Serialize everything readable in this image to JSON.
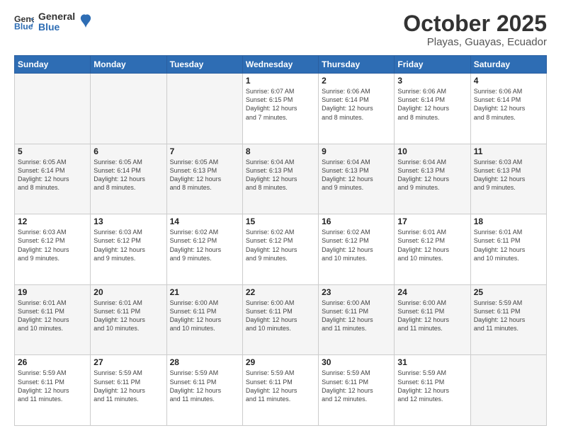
{
  "logo": {
    "line1": "General",
    "line2": "Blue"
  },
  "title": "October 2025",
  "subtitle": "Playas, Guayas, Ecuador",
  "days_of_week": [
    "Sunday",
    "Monday",
    "Tuesday",
    "Wednesday",
    "Thursday",
    "Friday",
    "Saturday"
  ],
  "weeks": [
    [
      {
        "day": "",
        "info": ""
      },
      {
        "day": "",
        "info": ""
      },
      {
        "day": "",
        "info": ""
      },
      {
        "day": "1",
        "info": "Sunrise: 6:07 AM\nSunset: 6:15 PM\nDaylight: 12 hours\nand 7 minutes."
      },
      {
        "day": "2",
        "info": "Sunrise: 6:06 AM\nSunset: 6:14 PM\nDaylight: 12 hours\nand 8 minutes."
      },
      {
        "day": "3",
        "info": "Sunrise: 6:06 AM\nSunset: 6:14 PM\nDaylight: 12 hours\nand 8 minutes."
      },
      {
        "day": "4",
        "info": "Sunrise: 6:06 AM\nSunset: 6:14 PM\nDaylight: 12 hours\nand 8 minutes."
      }
    ],
    [
      {
        "day": "5",
        "info": "Sunrise: 6:05 AM\nSunset: 6:14 PM\nDaylight: 12 hours\nand 8 minutes."
      },
      {
        "day": "6",
        "info": "Sunrise: 6:05 AM\nSunset: 6:14 PM\nDaylight: 12 hours\nand 8 minutes."
      },
      {
        "day": "7",
        "info": "Sunrise: 6:05 AM\nSunset: 6:13 PM\nDaylight: 12 hours\nand 8 minutes."
      },
      {
        "day": "8",
        "info": "Sunrise: 6:04 AM\nSunset: 6:13 PM\nDaylight: 12 hours\nand 8 minutes."
      },
      {
        "day": "9",
        "info": "Sunrise: 6:04 AM\nSunset: 6:13 PM\nDaylight: 12 hours\nand 9 minutes."
      },
      {
        "day": "10",
        "info": "Sunrise: 6:04 AM\nSunset: 6:13 PM\nDaylight: 12 hours\nand 9 minutes."
      },
      {
        "day": "11",
        "info": "Sunrise: 6:03 AM\nSunset: 6:13 PM\nDaylight: 12 hours\nand 9 minutes."
      }
    ],
    [
      {
        "day": "12",
        "info": "Sunrise: 6:03 AM\nSunset: 6:12 PM\nDaylight: 12 hours\nand 9 minutes."
      },
      {
        "day": "13",
        "info": "Sunrise: 6:03 AM\nSunset: 6:12 PM\nDaylight: 12 hours\nand 9 minutes."
      },
      {
        "day": "14",
        "info": "Sunrise: 6:02 AM\nSunset: 6:12 PM\nDaylight: 12 hours\nand 9 minutes."
      },
      {
        "day": "15",
        "info": "Sunrise: 6:02 AM\nSunset: 6:12 PM\nDaylight: 12 hours\nand 9 minutes."
      },
      {
        "day": "16",
        "info": "Sunrise: 6:02 AM\nSunset: 6:12 PM\nDaylight: 12 hours\nand 10 minutes."
      },
      {
        "day": "17",
        "info": "Sunrise: 6:01 AM\nSunset: 6:12 PM\nDaylight: 12 hours\nand 10 minutes."
      },
      {
        "day": "18",
        "info": "Sunrise: 6:01 AM\nSunset: 6:11 PM\nDaylight: 12 hours\nand 10 minutes."
      }
    ],
    [
      {
        "day": "19",
        "info": "Sunrise: 6:01 AM\nSunset: 6:11 PM\nDaylight: 12 hours\nand 10 minutes."
      },
      {
        "day": "20",
        "info": "Sunrise: 6:01 AM\nSunset: 6:11 PM\nDaylight: 12 hours\nand 10 minutes."
      },
      {
        "day": "21",
        "info": "Sunrise: 6:00 AM\nSunset: 6:11 PM\nDaylight: 12 hours\nand 10 minutes."
      },
      {
        "day": "22",
        "info": "Sunrise: 6:00 AM\nSunset: 6:11 PM\nDaylight: 12 hours\nand 10 minutes."
      },
      {
        "day": "23",
        "info": "Sunrise: 6:00 AM\nSunset: 6:11 PM\nDaylight: 12 hours\nand 11 minutes."
      },
      {
        "day": "24",
        "info": "Sunrise: 6:00 AM\nSunset: 6:11 PM\nDaylight: 12 hours\nand 11 minutes."
      },
      {
        "day": "25",
        "info": "Sunrise: 5:59 AM\nSunset: 6:11 PM\nDaylight: 12 hours\nand 11 minutes."
      }
    ],
    [
      {
        "day": "26",
        "info": "Sunrise: 5:59 AM\nSunset: 6:11 PM\nDaylight: 12 hours\nand 11 minutes."
      },
      {
        "day": "27",
        "info": "Sunrise: 5:59 AM\nSunset: 6:11 PM\nDaylight: 12 hours\nand 11 minutes."
      },
      {
        "day": "28",
        "info": "Sunrise: 5:59 AM\nSunset: 6:11 PM\nDaylight: 12 hours\nand 11 minutes."
      },
      {
        "day": "29",
        "info": "Sunrise: 5:59 AM\nSunset: 6:11 PM\nDaylight: 12 hours\nand 11 minutes."
      },
      {
        "day": "30",
        "info": "Sunrise: 5:59 AM\nSunset: 6:11 PM\nDaylight: 12 hours\nand 12 minutes."
      },
      {
        "day": "31",
        "info": "Sunrise: 5:59 AM\nSunset: 6:11 PM\nDaylight: 12 hours\nand 12 minutes."
      },
      {
        "day": "",
        "info": ""
      }
    ]
  ]
}
